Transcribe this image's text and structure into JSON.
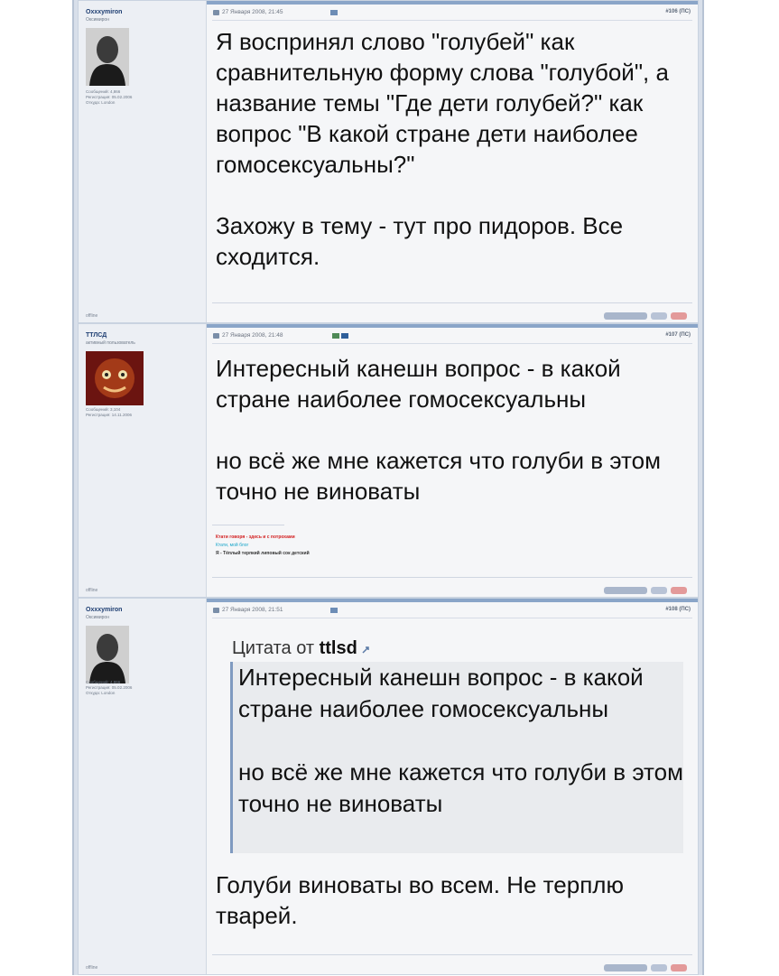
{
  "posts": [
    {
      "username": "Oxxxymiron",
      "usertitle": "Оксимирон",
      "stats": [
        "Сообщений: 4,866",
        "Регистрация: 05.02.2006",
        "Откуда: London"
      ],
      "date": "27 Января 2008, 21:45",
      "number": "#106 (ПС)",
      "status": "offline",
      "paragraphs": [
        "Я воспринял слово \"голубей\" как сравнительную форму слова \"голубой\", а название темы \"Где дети голубей?\" как вопрос \"В какой стране дети наиболее гомосексуальны?\"",
        "Захожу в тему - тут про пидоров. Все сходится."
      ]
    },
    {
      "username": "ТТЛСД",
      "usertitle": "активный пользователь",
      "stats": [
        "Сообщений: 3,104",
        "Регистрация: 14.11.2006"
      ],
      "date": "27 Января 2008, 21:48",
      "number": "#107 (ПС)",
      "status": "offline",
      "paragraphs": [
        "Интересный канешн вопрос - в какой стране наиболее гомосексуальны",
        "но всё же мне кажется что голуби в этом точно не виноваты"
      ],
      "signature": [
        "Ктати говоря - здесь и с потрохами",
        "Ктати, мой блог",
        "Я - Тёплый терпкий липовый сок детский"
      ]
    },
    {
      "username": "Oxxxymiron",
      "usertitle": "Оксимирон",
      "stats": [
        "Сообщений: 4,866",
        "Регистрация: 05.02.2006",
        "Откуда: London"
      ],
      "date": "27 Января 2008, 21:51",
      "number": "#108 (ПС)",
      "status": "offline",
      "quote_prefix": "Цитата от",
      "quote_author": "ttlsd",
      "quote": [
        "Интересный канешн вопрос - в какой стране наиболее гомосексуальны",
        "но всё же мне кажется что голуби в этом точно не виноваты"
      ],
      "paragraphs": [
        "Голуби виноваты во всем. Не терплю тварей."
      ]
    }
  ],
  "colors": {
    "username": "#1d3d71",
    "signature_red": "#d32020",
    "signature_cyan": "#17a5c9",
    "quote_border": "#7f9ac0"
  },
  "icons": [
    "post-date-icon",
    "post-type-icon",
    "quote-button",
    "multi-quote-button",
    "report-button"
  ]
}
